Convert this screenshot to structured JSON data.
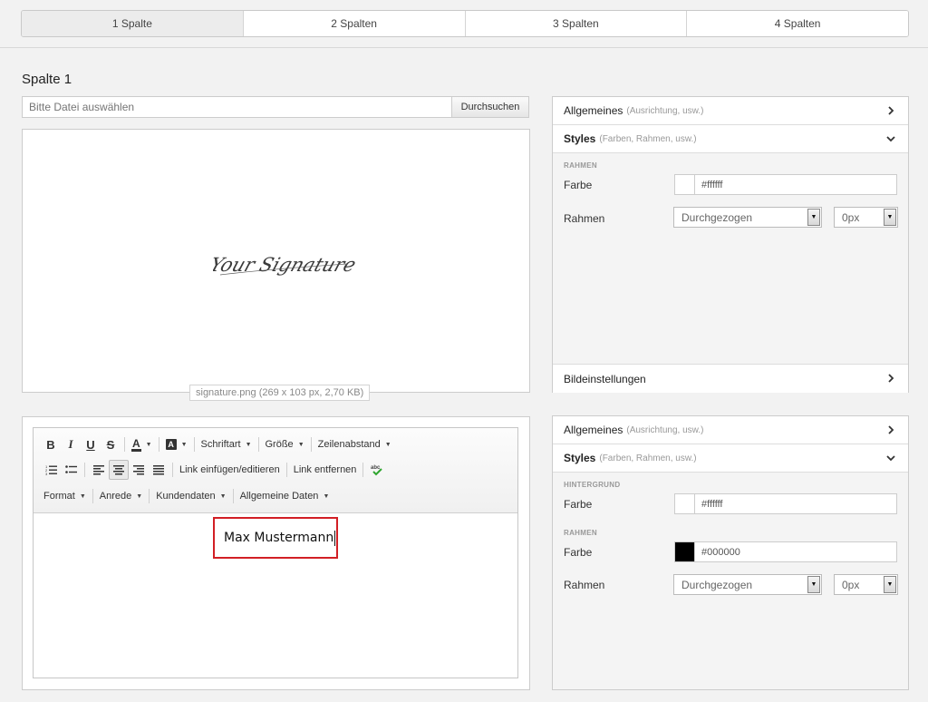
{
  "column_tabs": [
    "1 Spalte",
    "2 Spalten",
    "3 Spalten",
    "4 Spalten"
  ],
  "column_title": "Spalte 1",
  "file": {
    "placeholder": "Bitte Datei auswählen",
    "browse_label": "Durchsuchen"
  },
  "image": {
    "signature_text": "Your Signature",
    "caption": "signature.png (269 x 103 px, 2,70 KB)"
  },
  "editor": {
    "font_label": "Schriftart",
    "size_label": "Größe",
    "line_spacing_label": "Zeilenabstand",
    "link_insert_label": "Link einfügen/editieren",
    "link_remove_label": "Link entfernen",
    "format_label": "Format",
    "salutation_label": "Anrede",
    "customer_data_label": "Kundendaten",
    "general_data_label": "Allgemeine Daten",
    "spellcheck_text": "abc",
    "content_text": "Max Mustermann"
  },
  "panel_image": {
    "general_title": "Allgemeines",
    "general_sub": "(Ausrichtung, usw.)",
    "styles_title": "Styles",
    "styles_sub": "(Farben, Rahmen, usw.)",
    "border_section": "RAHMEN",
    "color_label": "Farbe",
    "color_value": "#ffffff",
    "border_label": "Rahmen",
    "border_style": "Durchgezogen",
    "border_width": "0px",
    "image_settings": "Bildeinstellungen"
  },
  "panel_text": {
    "general_title": "Allgemeines",
    "general_sub": "(Ausrichtung, usw.)",
    "styles_title": "Styles",
    "styles_sub": "(Farben, Rahmen, usw.)",
    "background_section": "HINTERGRUND",
    "bg_color_label": "Farbe",
    "bg_color_value": "#ffffff",
    "border_section": "RAHMEN",
    "border_color_label": "Farbe",
    "border_color_value": "#000000",
    "border_label": "Rahmen",
    "border_style": "Durchgezogen",
    "border_width": "0px"
  },
  "colors": {
    "highlight_border": "#d21f25",
    "swatch_white": "#ffffff",
    "swatch_black": "#000000"
  }
}
